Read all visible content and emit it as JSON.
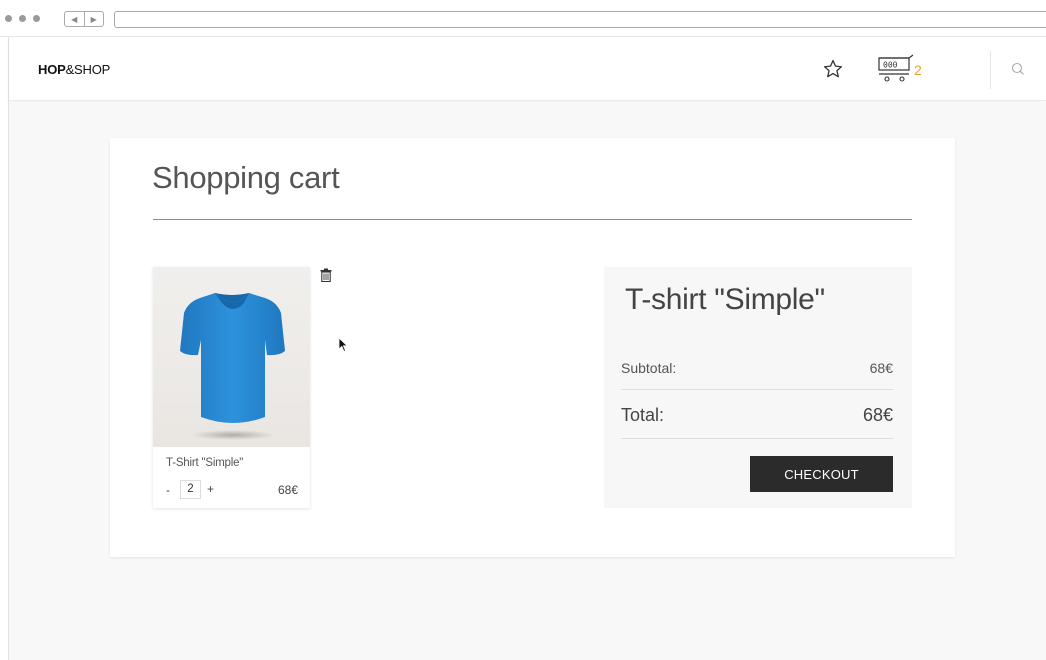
{
  "brand": {
    "bold": "HOP",
    "rest": "&SHOP"
  },
  "header": {
    "favorites_icon": "star-icon",
    "cart_icon": "cart-icon",
    "cart_count": "2",
    "search_icon": "search-icon"
  },
  "cart": {
    "title": "Shopping cart",
    "items": [
      {
        "name": "T-Shirt \"Simple\"",
        "quantity": "2",
        "minus": "-",
        "plus": "+",
        "price": "68€",
        "image_color": "#2a8bd4"
      }
    ],
    "remove_icon": "trash-icon"
  },
  "summary": {
    "title": "T-shirt \"Simple\"",
    "subtotal_label": "Subtotal:",
    "subtotal_value": "68€",
    "total_label": "Total:",
    "total_value": "68€",
    "checkout_label": "CHECKOUT"
  },
  "colors": {
    "accent": "#e8a23a",
    "button": "#2b2b2b",
    "shirt": "#2a8bd4"
  }
}
